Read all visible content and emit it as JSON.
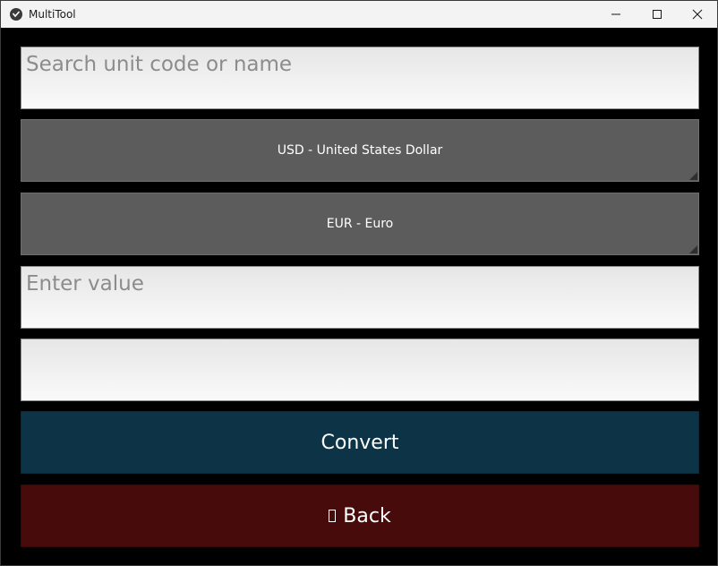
{
  "window": {
    "title": "MultiTool"
  },
  "search": {
    "placeholder": "Search unit code or name",
    "value": ""
  },
  "from_unit": {
    "selected": "USD - United States Dollar"
  },
  "to_unit": {
    "selected": "EUR - Euro"
  },
  "value_input": {
    "placeholder": "Enter value",
    "value": ""
  },
  "result": {
    "value": ""
  },
  "buttons": {
    "convert": "Convert",
    "back": "Back"
  },
  "colors": {
    "convert_bg": "#0c3346",
    "back_bg": "#470b0b",
    "dropdown_bg": "#5c5c5c",
    "window_bg": "#000000"
  }
}
